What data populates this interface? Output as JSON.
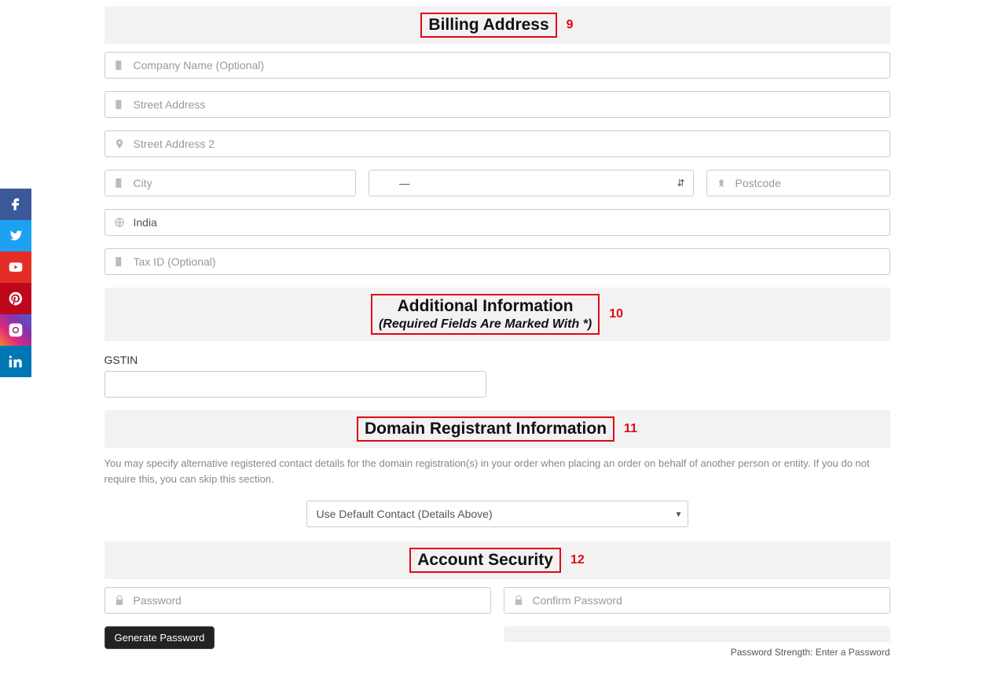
{
  "annotations": {
    "billing": "9",
    "additional": "10",
    "domain": "11",
    "security": "12"
  },
  "sections": {
    "billing": {
      "title": "Billing Address"
    },
    "additional": {
      "title": "Additional Information",
      "subtitle": "(Required Fields Are Marked With *)"
    },
    "domain": {
      "title": "Domain Registrant Information"
    },
    "security": {
      "title": "Account Security"
    }
  },
  "billing": {
    "company_ph": "Company Name (Optional)",
    "street1_ph": "Street Address",
    "street2_ph": "Street Address 2",
    "city_ph": "City",
    "state_selected": "—",
    "postcode_ph": "Postcode",
    "country_value": "India",
    "taxid_ph": "Tax ID (Optional)"
  },
  "additional": {
    "gstin_label": "GSTIN"
  },
  "domain": {
    "help_text": "You may specify alternative registered contact details for the domain registration(s) in your order when placing an order on behalf of another person or entity. If you do not require this, you can skip this section.",
    "contact_selected": "Use Default Contact (Details Above)"
  },
  "security": {
    "password_ph": "Password",
    "confirm_ph": "Confirm Password",
    "gen_button": "Generate Password",
    "strength_text": "Password Strength: Enter a Password"
  },
  "social": {
    "facebook": {
      "bg": "#3b5998"
    },
    "twitter": {
      "bg": "#1da1f2"
    },
    "youtube": {
      "bg": "#e52d27"
    },
    "pinterest": {
      "bg": "#bd081c"
    },
    "instagram": {
      "bg": "#c13584"
    },
    "linkedin": {
      "bg": "#0077b5"
    }
  }
}
